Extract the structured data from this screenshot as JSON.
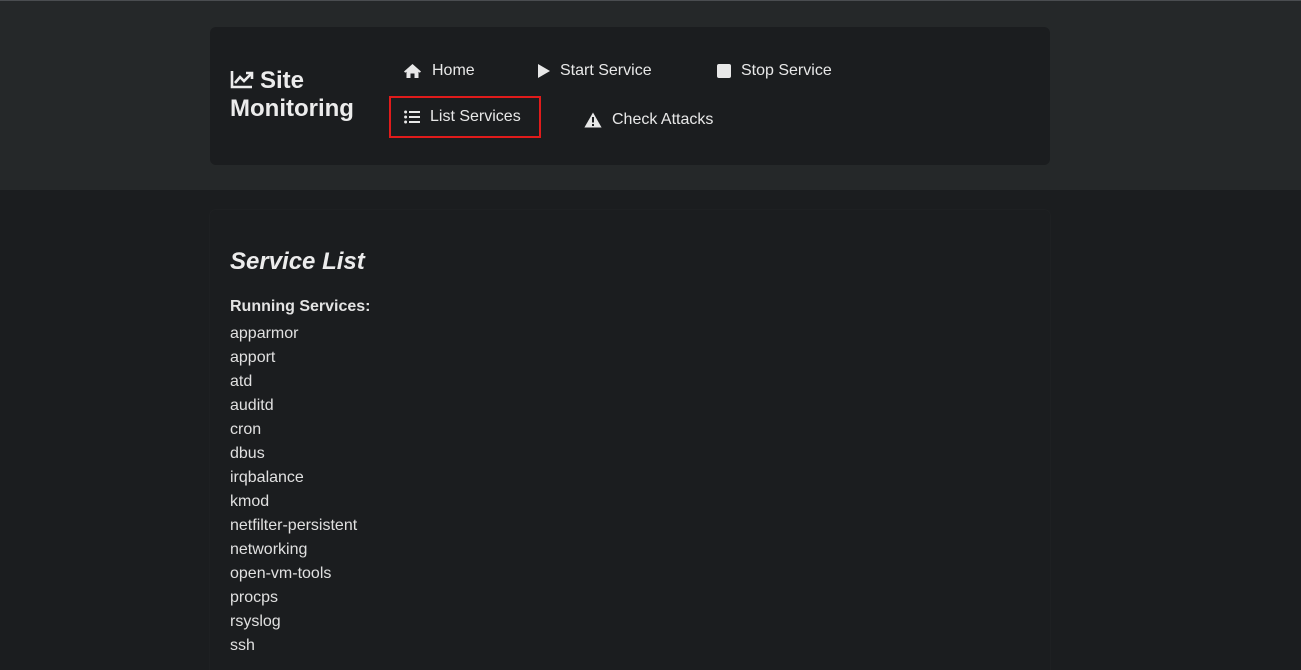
{
  "brand": {
    "line1": "Site",
    "line2": "Monitoring",
    "icon": "chart-line-icon"
  },
  "nav": {
    "home": {
      "label": "Home",
      "icon": "home-icon"
    },
    "start": {
      "label": "Start Service",
      "icon": "play-icon"
    },
    "stop": {
      "label": "Stop Service",
      "icon": "stop-icon"
    },
    "list": {
      "label": "List Services",
      "icon": "list-icon",
      "active": true
    },
    "check": {
      "label": "Check Attacks",
      "icon": "warning-icon"
    }
  },
  "page": {
    "title": "Service List",
    "section_label": "Running Services:"
  },
  "services": [
    "apparmor",
    "apport",
    "atd",
    "auditd",
    "cron",
    "dbus",
    "irqbalance",
    "kmod",
    "netfilter-persistent",
    "networking",
    "open-vm-tools",
    "procps",
    "rsyslog",
    "ssh"
  ],
  "colors": {
    "background": "#1b1d1f",
    "header_band": "#252829",
    "highlight_border": "#e01b1b",
    "text": "#e3e3e3"
  }
}
